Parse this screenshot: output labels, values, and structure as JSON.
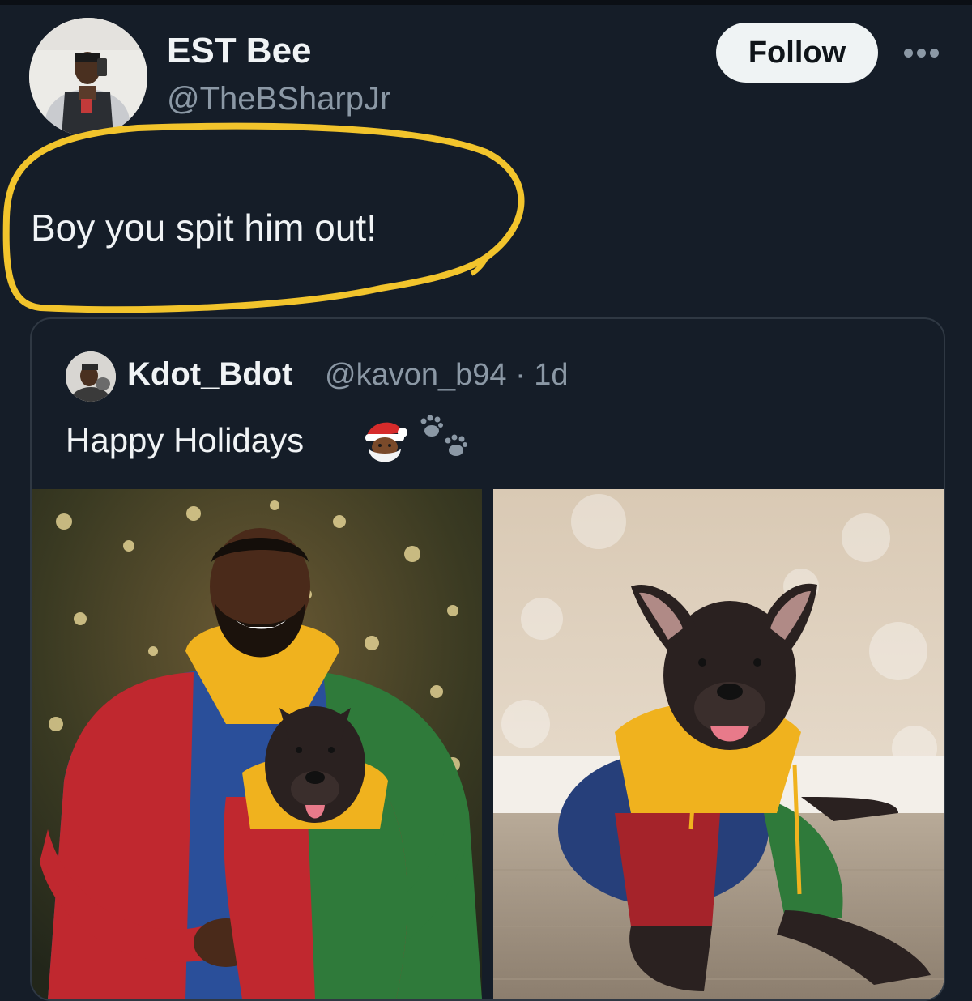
{
  "post": {
    "display_name": "EST Bee",
    "handle": "@TheBSharpJr",
    "follow_label": "Follow",
    "more_icon": "more-dots-icon",
    "text": "Boy you spit him out!",
    "highlight_color": "#f2c42c"
  },
  "quote": {
    "display_name": "Kdot_Bdot",
    "handle_time": "@kavon_b94 · 1d",
    "text": "Happy Holidays",
    "emojis": [
      "santa-emoji",
      "paw-prints-emoji"
    ],
    "media": [
      "man-with-dog-holiday-photo",
      "dog-in-hoodie-photo"
    ]
  },
  "colors": {
    "background": "#151d28",
    "primary_text": "#f0f3f5",
    "secondary_text": "#8b98a5",
    "border": "#2f3843",
    "follow_bg": "#eff3f4"
  }
}
